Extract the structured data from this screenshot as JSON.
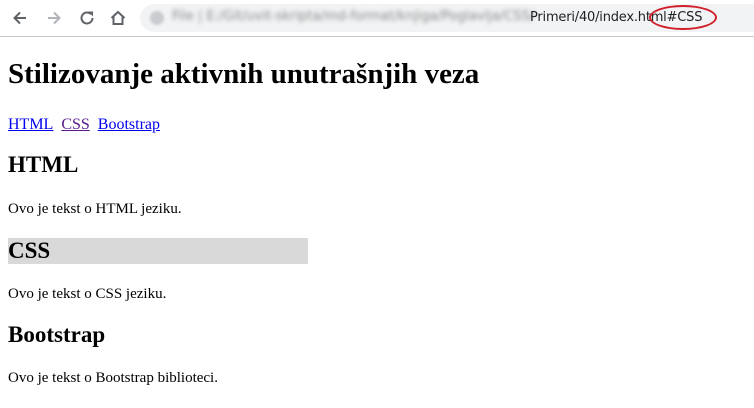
{
  "browser": {
    "url_prefix": "File | E:/Git/uvit-skripta/md-format/knjiga/Poglavlja/CSS/",
    "url_visible": "Primeri/40/index.html#CSS"
  },
  "page": {
    "title": "Stilizovanje aktivnih unutrašnjih veza",
    "nav_links": [
      {
        "label": "HTML"
      },
      {
        "label": "CSS"
      },
      {
        "label": "Bootstrap"
      }
    ],
    "sections": [
      {
        "heading": "HTML",
        "text": "Ovo je tekst o HTML jeziku."
      },
      {
        "heading": "CSS",
        "text": "Ovo je tekst o CSS jeziku."
      },
      {
        "heading": "Bootstrap",
        "text": "Ovo je tekst o Bootstrap biblioteci."
      }
    ]
  },
  "colors": {
    "active_section_bg": "#d9d9d9",
    "link": "#0000ee",
    "visited_link": "#551a8b",
    "annotation": "#d2202a"
  },
  "icons": [
    "back-arrow-icon",
    "forward-arrow-icon",
    "reload-icon",
    "home-icon",
    "lock-icon"
  ]
}
